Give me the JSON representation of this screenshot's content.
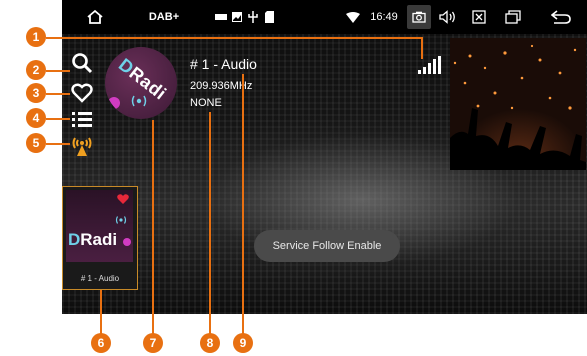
{
  "statusbar": {
    "home_icon": "home-icon",
    "mode_label": "DAB+",
    "time": "16:49",
    "icons": [
      "bt-icon",
      "image-icon",
      "usb-icon",
      "sd-card-icon",
      "wifi-icon",
      "camera-icon",
      "volume-icon",
      "close-box-icon",
      "windows-icon",
      "back-icon"
    ]
  },
  "side_icons": [
    "search-icon",
    "heart-icon",
    "list-icon",
    "antenna-icon"
  ],
  "station": {
    "logo_text_a": "D",
    "logo_text_b": "Radi",
    "title": "# 1 - Audio",
    "frequency": "209.936MHz",
    "pty": "NONE"
  },
  "preset": {
    "logo_d": "D",
    "logo_radio": "Radi",
    "label": "# 1 - Audio"
  },
  "toast": "Service Follow Enable",
  "markers": [
    "1",
    "2",
    "3",
    "4",
    "5",
    "6",
    "7",
    "8",
    "9"
  ],
  "colors": {
    "marker": "#e87011",
    "accent_heart": "#e8283a",
    "antenna": "#f0a020"
  }
}
